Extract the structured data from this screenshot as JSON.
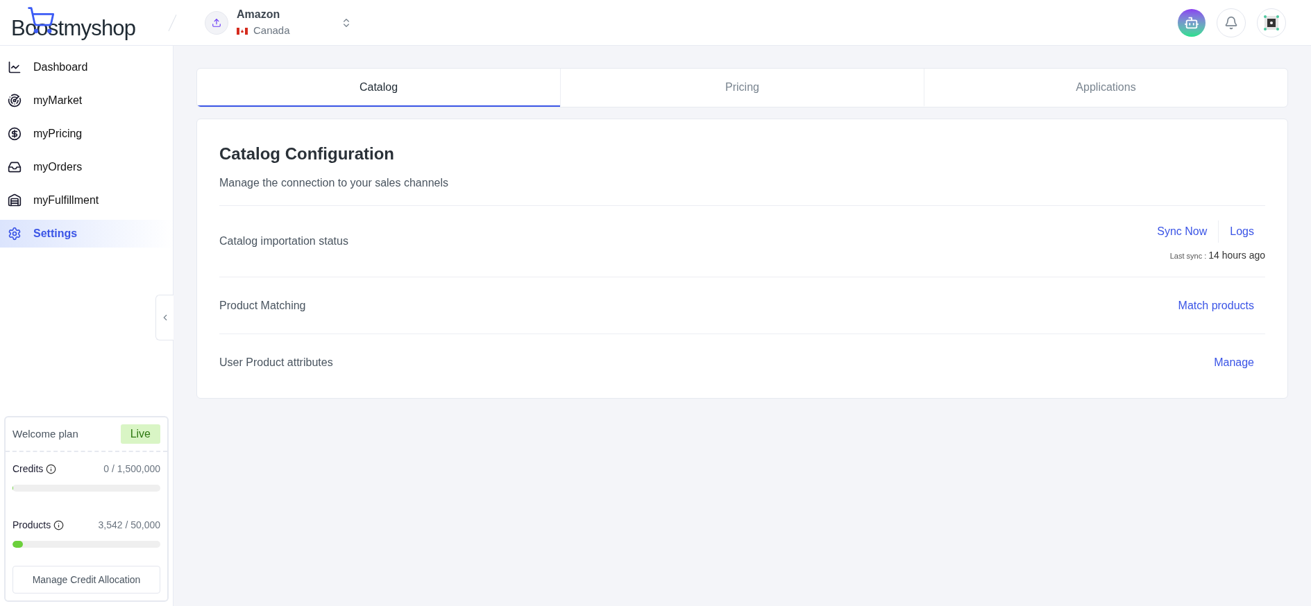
{
  "header": {
    "logo": "Boostmyshop",
    "store": {
      "name": "Amazon",
      "country": "Canada"
    }
  },
  "sidebar": {
    "items": [
      {
        "label": "Dashboard",
        "selected": false
      },
      {
        "label": "myMarket",
        "selected": false
      },
      {
        "label": "myPricing",
        "selected": false
      },
      {
        "label": "myOrders",
        "selected": false
      },
      {
        "label": "myFulfillment",
        "selected": false
      },
      {
        "label": "Settings",
        "selected": true
      }
    ]
  },
  "plan": {
    "title": "Welcome plan",
    "badge": "Live",
    "meters": [
      {
        "label": "Credits",
        "reading": "0 / 1,500,000",
        "level": 0
      },
      {
        "label": "Products",
        "reading": "3,542 / 50,000",
        "level": 0.07
      }
    ],
    "button": "Manage Credit Allocation"
  },
  "tabs": [
    {
      "label": "Catalog",
      "selected": true
    },
    {
      "label": "Pricing",
      "selected": false
    },
    {
      "label": "Applications",
      "selected": false
    }
  ],
  "card": {
    "title": "Catalog Configuration",
    "subtitle": "Manage the connection to your sales channels",
    "rows": [
      {
        "label": "Catalog importation status",
        "actions": [
          "Sync Now",
          "Logs"
        ],
        "last_sync_label": "Last sync :",
        "last_sync_value": "14 hours ago"
      },
      {
        "label": "Product Matching",
        "actions": [
          "Match products"
        ]
      },
      {
        "label": "User Product attributes",
        "actions": [
          "Manage"
        ]
      }
    ]
  }
}
